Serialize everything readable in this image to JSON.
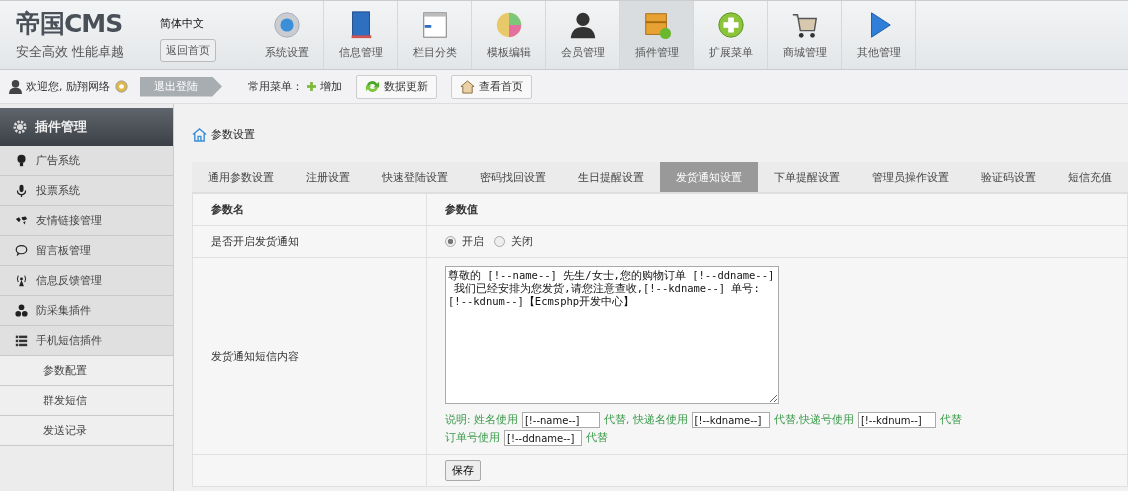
{
  "header": {
    "logo_title": "帝国CMS",
    "logo_slogan": "安全高效  性能卓越",
    "language": "简体中文",
    "home_button": "返回首页",
    "nav": [
      {
        "label": "系统设置",
        "selected": false
      },
      {
        "label": "信息管理",
        "selected": false
      },
      {
        "label": "栏目分类",
        "selected": false
      },
      {
        "label": "模板编辑",
        "selected": false
      },
      {
        "label": "会员管理",
        "selected": false
      },
      {
        "label": "插件管理",
        "selected": true
      },
      {
        "label": "扩展菜单",
        "selected": false
      },
      {
        "label": "商城管理",
        "selected": false
      },
      {
        "label": "其他管理",
        "selected": false
      }
    ]
  },
  "user_bar": {
    "welcome": "欢迎您, 励翔网络",
    "logout": "退出登陆",
    "menu_label": "常用菜单：",
    "add": "增加",
    "buttons": [
      "数据更新",
      "查看首页"
    ]
  },
  "sidebar": {
    "title": "插件管理",
    "items": [
      {
        "label": "广告系统",
        "kind": "group"
      },
      {
        "label": "投票系统",
        "kind": "group"
      },
      {
        "label": "友情链接管理",
        "kind": "group"
      },
      {
        "label": "留言板管理",
        "kind": "group"
      },
      {
        "label": "信息反馈管理",
        "kind": "group"
      },
      {
        "label": "防采集插件",
        "kind": "group"
      },
      {
        "label": "手机短信插件",
        "kind": "group"
      },
      {
        "label": "参数配置",
        "kind": "sub"
      },
      {
        "label": "群发短信",
        "kind": "sub"
      },
      {
        "label": "发送记录",
        "kind": "sub"
      }
    ]
  },
  "breadcrumb": "参数设置",
  "tabs": [
    {
      "label": "通用参数设置",
      "selected": false
    },
    {
      "label": "注册设置",
      "selected": false
    },
    {
      "label": "快速登陆设置",
      "selected": false
    },
    {
      "label": "密码找回设置",
      "selected": false
    },
    {
      "label": "生日提醒设置",
      "selected": false
    },
    {
      "label": "发货通知设置",
      "selected": true
    },
    {
      "label": "下单提醒设置",
      "selected": false
    },
    {
      "label": "管理员操作设置",
      "selected": false
    },
    {
      "label": "验证码设置",
      "selected": false
    },
    {
      "label": "短信充值",
      "selected": false
    }
  ],
  "table": {
    "columns": [
      "参数名",
      "参数值"
    ],
    "switch_row": {
      "label": "是否开启发货通知",
      "options": [
        {
          "label": "开启",
          "selected": true
        },
        {
          "label": "关闭",
          "selected": false
        }
      ]
    },
    "content_row": {
      "label": "发货通知短信内容",
      "value": "尊敬的 [!--name--] 先生/女士,您的购物订单 [!--ddname--]\n 我们已经安排为您发货,请您注意查收,[!--kdname--] 单号:\n[!--kdnum--]【Ecmsphp开发中心】",
      "note_lines": [
        [
          {
            "kind": "text",
            "text": "说明: 姓名使用"
          },
          {
            "kind": "field",
            "value": "[!--name--]"
          },
          {
            "kind": "text",
            "text": "代替, 快递名使用"
          },
          {
            "kind": "field",
            "value": "[!--kdname--]"
          },
          {
            "kind": "text",
            "text": "代替,快递号使用"
          },
          {
            "kind": "field",
            "value": "[!--kdnum--]"
          },
          {
            "kind": "text",
            "text": "代替"
          }
        ],
        [
          {
            "kind": "text",
            "text": "订单号使用"
          },
          {
            "kind": "field",
            "value": "[!--ddname--]"
          },
          {
            "kind": "text",
            "text": "代替"
          }
        ]
      ]
    },
    "save_button": "保存"
  }
}
